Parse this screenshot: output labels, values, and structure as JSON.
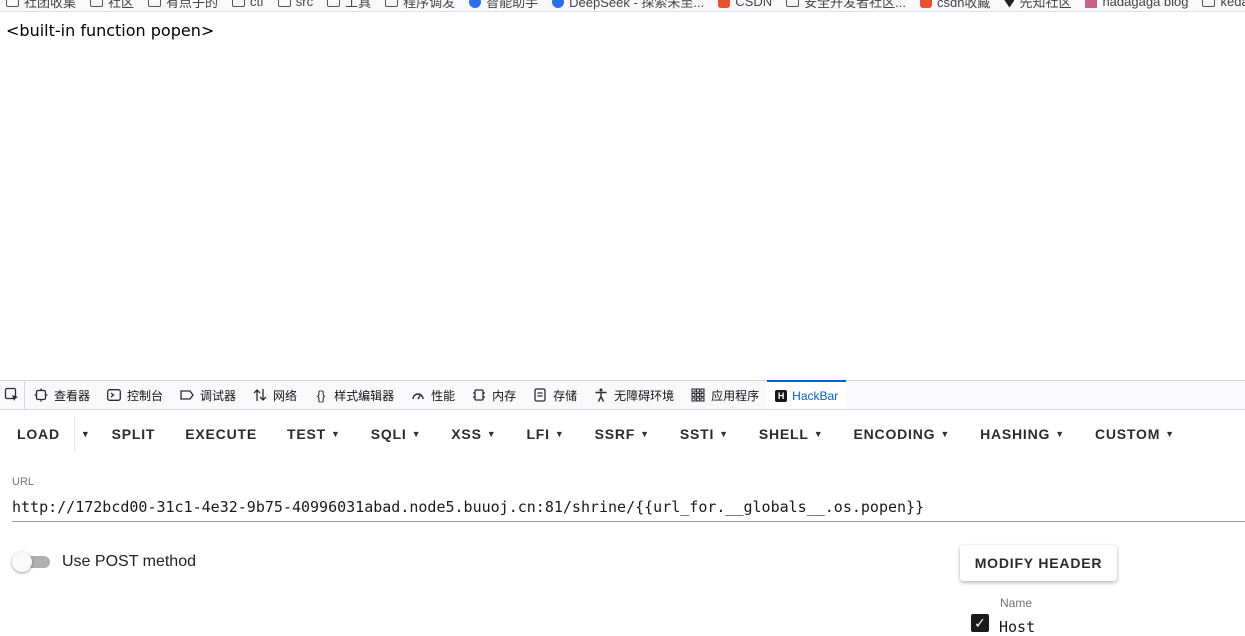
{
  "bookmarks": [
    {
      "label": "社团收集",
      "icon": "folder-icon"
    },
    {
      "label": "社区",
      "icon": "folder-icon"
    },
    {
      "label": "有点子的",
      "icon": "folder-icon"
    },
    {
      "label": "ctf",
      "icon": "folder-icon"
    },
    {
      "label": "src",
      "icon": "folder-icon"
    },
    {
      "label": "工具",
      "icon": "folder-icon"
    },
    {
      "label": "程序调发",
      "icon": "folder-icon"
    },
    {
      "label": "智能助手",
      "icon": "globe-icon"
    },
    {
      "label": "DeepSeek - 探索未至...",
      "icon": "deepseek-icon"
    },
    {
      "label": "CSDN",
      "icon": "csdn-icon"
    },
    {
      "label": "安全开发者社区...",
      "icon": "folder-icon"
    },
    {
      "label": "csdn收藏",
      "icon": "csdn-icon"
    },
    {
      "label": "先知社区",
      "icon": "xianzhi-icon"
    },
    {
      "label": "nadagaga blog",
      "icon": "blog-icon"
    },
    {
      "label": "kedaolm",
      "icon": "folder-icon"
    }
  ],
  "page": {
    "output": "<built-in function popen>"
  },
  "devtools": {
    "tabs": [
      {
        "label": "查看器",
        "icon": "inspector-icon"
      },
      {
        "label": "控制台",
        "icon": "console-icon"
      },
      {
        "label": "调试器",
        "icon": "debugger-icon"
      },
      {
        "label": "网络",
        "icon": "network-icon"
      },
      {
        "label": "样式编辑器",
        "icon": "style-editor-icon"
      },
      {
        "label": "性能",
        "icon": "performance-icon"
      },
      {
        "label": "内存",
        "icon": "memory-icon"
      },
      {
        "label": "存储",
        "icon": "storage-icon"
      },
      {
        "label": "无障碍环境",
        "icon": "accessibility-icon"
      },
      {
        "label": "应用程序",
        "icon": "application-icon"
      },
      {
        "label": "HackBar",
        "icon": "hackbar-icon"
      }
    ],
    "active_tab": "HackBar",
    "accent_color": "#0061e0"
  },
  "hackbar": {
    "toolbar": {
      "load": "LOAD",
      "split": "SPLIT",
      "execute": "EXECUTE",
      "menus": [
        "TEST",
        "SQLI",
        "XSS",
        "LFI",
        "SSRF",
        "SSTI",
        "SHELL",
        "ENCODING",
        "HASHING",
        "CUSTOM"
      ]
    },
    "url_label": "URL",
    "url_value": "http://172bcd00-31c1-4e32-9b75-40996031abad.node5.buuoj.cn:81/shrine/{{url_for.__globals__.os.popen}}",
    "post_toggle_label": "Use POST method",
    "post_enabled": false,
    "modify_header": "MODIFY HEADER",
    "header_name_label": "Name",
    "header_name_value": "Host",
    "header_checked": true
  }
}
